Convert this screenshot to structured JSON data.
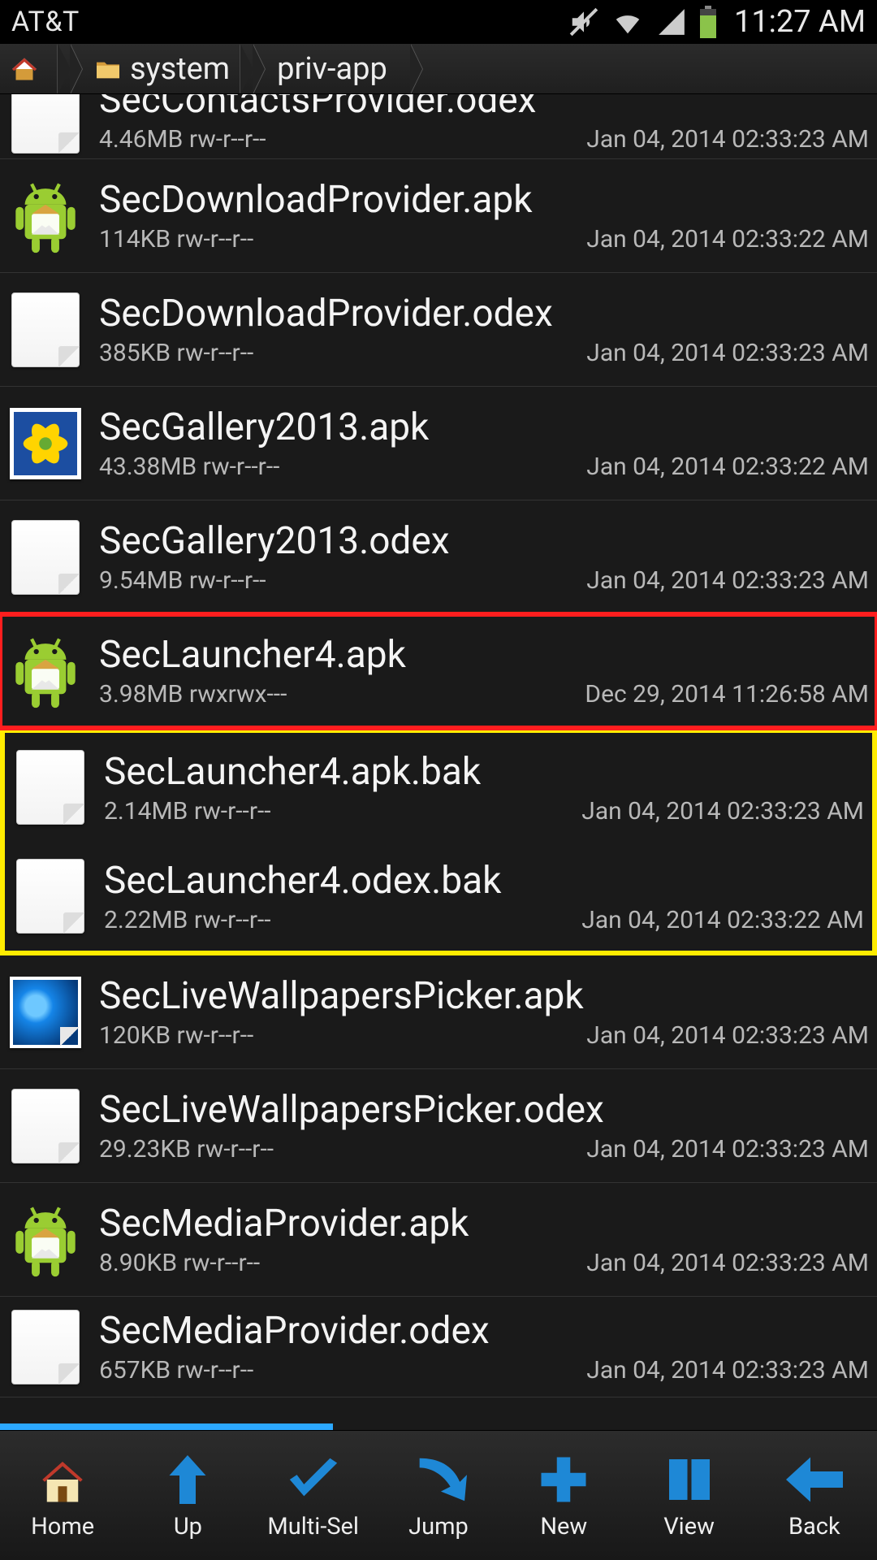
{
  "status": {
    "carrier": "AT&T",
    "time": "11:27 AM"
  },
  "breadcrumb": {
    "items": [
      {
        "label": "",
        "icon": "home"
      },
      {
        "label": "system",
        "icon": "folder"
      },
      {
        "label": "priv-app",
        "icon": ""
      }
    ]
  },
  "files": [
    {
      "name": "SecContactsProvider.odex",
      "size": "4.46MB",
      "perm": "rw-r--r--",
      "date": "Jan 04, 2014 02:33:23 AM",
      "icon": "doc",
      "partial": "top"
    },
    {
      "name": "SecDownloadProvider.apk",
      "size": "114KB",
      "perm": "rw-r--r--",
      "date": "Jan 04, 2014 02:33:22 AM",
      "icon": "apk"
    },
    {
      "name": "SecDownloadProvider.odex",
      "size": "385KB",
      "perm": "rw-r--r--",
      "date": "Jan 04, 2014 02:33:23 AM",
      "icon": "doc"
    },
    {
      "name": "SecGallery2013.apk",
      "size": "43.38MB",
      "perm": "rw-r--r--",
      "date": "Jan 04, 2014 02:33:22 AM",
      "icon": "gallery"
    },
    {
      "name": "SecGallery2013.odex",
      "size": "9.54MB",
      "perm": "rw-r--r--",
      "date": "Jan 04, 2014 02:33:23 AM",
      "icon": "doc"
    },
    {
      "name": "SecLauncher4.apk",
      "size": "3.98MB",
      "perm": "rwxrwx---",
      "date": "Dec 29, 2014 11:26:58 AM",
      "icon": "apk",
      "highlight": "red"
    },
    {
      "name": "SecLauncher4.apk.bak",
      "size": "2.14MB",
      "perm": "rw-r--r--",
      "date": "Jan 04, 2014 02:33:23 AM",
      "icon": "doc",
      "highlight": "yellow-top"
    },
    {
      "name": "SecLauncher4.odex.bak",
      "size": "2.22MB",
      "perm": "rw-r--r--",
      "date": "Jan 04, 2014 02:33:22 AM",
      "icon": "doc",
      "highlight": "yellow-bottom"
    },
    {
      "name": "SecLiveWallpapersPicker.apk",
      "size": "120KB",
      "perm": "rw-r--r--",
      "date": "Jan 04, 2014 02:33:23 AM",
      "icon": "lwp"
    },
    {
      "name": "SecLiveWallpapersPicker.odex",
      "size": "29.23KB",
      "perm": "rw-r--r--",
      "date": "Jan 04, 2014 02:33:23 AM",
      "icon": "doc"
    },
    {
      "name": "SecMediaProvider.apk",
      "size": "8.90KB",
      "perm": "rw-r--r--",
      "date": "Jan 04, 2014 02:33:23 AM",
      "icon": "apk"
    },
    {
      "name": "SecMediaProvider.odex",
      "size": "657KB",
      "perm": "rw-r--r--",
      "date": "Jan 04, 2014 02:33:23 AM",
      "icon": "doc",
      "partial": "bottom"
    }
  ],
  "toolbar": {
    "buttons": [
      {
        "label": "Home",
        "icon": "home"
      },
      {
        "label": "Up",
        "icon": "up"
      },
      {
        "label": "Multi-Sel",
        "icon": "check"
      },
      {
        "label": "Jump",
        "icon": "jump"
      },
      {
        "label": "New",
        "icon": "plus"
      },
      {
        "label": "View",
        "icon": "grid"
      },
      {
        "label": "Back",
        "icon": "back"
      }
    ]
  },
  "scroll": {
    "percent": 38
  }
}
